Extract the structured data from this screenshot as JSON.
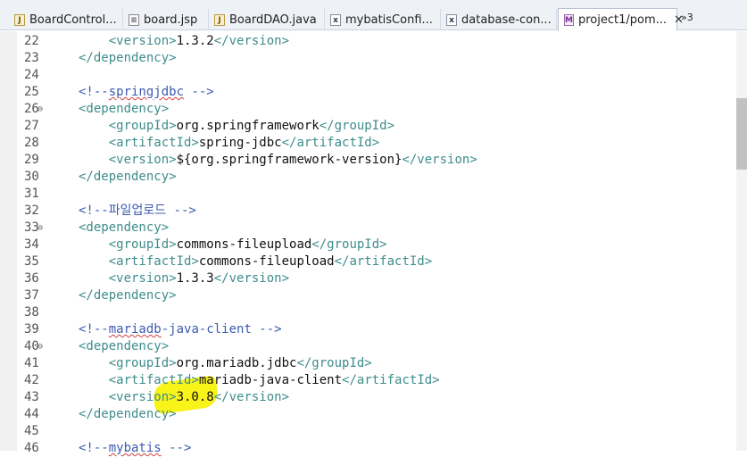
{
  "tabs": [
    {
      "label": "BoardControl...",
      "icon": "java-file-icon"
    },
    {
      "label": "board.jsp",
      "icon": "jsp-file-icon"
    },
    {
      "label": "BoardDAO.java",
      "icon": "java-file-icon"
    },
    {
      "label": "mybatisConfi...",
      "icon": "xml-file-icon"
    },
    {
      "label": "database-con...",
      "icon": "xml-file-icon"
    },
    {
      "label": "project1/pom...",
      "icon": "pom-file-icon",
      "active": true
    }
  ],
  "overflow_label": "»3",
  "lines": [
    {
      "n": "22",
      "fold": false,
      "indent": "    ",
      "parts": [
        [
          "tag",
          "<version>"
        ],
        [
          "txt",
          "1.3.2"
        ],
        [
          "tag",
          "</version>"
        ]
      ]
    },
    {
      "n": "23",
      "fold": false,
      "indent": "",
      "parts": [
        [
          "tag",
          "</dependency>"
        ]
      ]
    },
    {
      "n": "24",
      "fold": false,
      "indent": "",
      "parts": []
    },
    {
      "n": "25",
      "fold": false,
      "indent": "",
      "parts": [
        [
          "cmt",
          "<!--"
        ],
        [
          "cmt-sq",
          "springjdbc"
        ],
        [
          "cmt",
          " -->"
        ]
      ]
    },
    {
      "n": "26",
      "fold": true,
      "indent": "",
      "parts": [
        [
          "tag",
          "<dependency>"
        ]
      ]
    },
    {
      "n": "27",
      "fold": false,
      "indent": "    ",
      "parts": [
        [
          "tag",
          "<groupId>"
        ],
        [
          "txt",
          "org.springframework"
        ],
        [
          "tag",
          "</groupId>"
        ]
      ]
    },
    {
      "n": "28",
      "fold": false,
      "indent": "    ",
      "parts": [
        [
          "tag",
          "<artifactId>"
        ],
        [
          "txt",
          "spring-jdbc"
        ],
        [
          "tag",
          "</artifactId>"
        ]
      ]
    },
    {
      "n": "29",
      "fold": false,
      "indent": "    ",
      "parts": [
        [
          "tag",
          "<version>"
        ],
        [
          "txt",
          "${org.springframework-version}"
        ],
        [
          "tag",
          "</version>"
        ]
      ]
    },
    {
      "n": "30",
      "fold": false,
      "indent": "",
      "parts": [
        [
          "tag",
          "</dependency>"
        ]
      ]
    },
    {
      "n": "31",
      "fold": false,
      "indent": "",
      "parts": []
    },
    {
      "n": "32",
      "fold": false,
      "indent": "",
      "parts": [
        [
          "cmt",
          "<!--파일업로드 -->"
        ]
      ]
    },
    {
      "n": "33",
      "fold": true,
      "indent": "",
      "parts": [
        [
          "tag",
          "<dependency>"
        ]
      ]
    },
    {
      "n": "34",
      "fold": false,
      "indent": "    ",
      "parts": [
        [
          "tag",
          "<groupId>"
        ],
        [
          "txt",
          "commons-fileupload"
        ],
        [
          "tag",
          "</groupId>"
        ]
      ]
    },
    {
      "n": "35",
      "fold": false,
      "indent": "    ",
      "parts": [
        [
          "tag",
          "<artifactId>"
        ],
        [
          "txt",
          "commons-fileupload"
        ],
        [
          "tag",
          "</artifactId>"
        ]
      ]
    },
    {
      "n": "36",
      "fold": false,
      "indent": "    ",
      "parts": [
        [
          "tag",
          "<version>"
        ],
        [
          "txt",
          "1.3.3"
        ],
        [
          "tag",
          "</version>"
        ]
      ]
    },
    {
      "n": "37",
      "fold": false,
      "indent": "",
      "parts": [
        [
          "tag",
          "</dependency>"
        ]
      ]
    },
    {
      "n": "38",
      "fold": false,
      "indent": "",
      "parts": []
    },
    {
      "n": "39",
      "fold": false,
      "indent": "",
      "parts": [
        [
          "cmt",
          "<!--"
        ],
        [
          "cmt-sq",
          "mariadb"
        ],
        [
          "cmt",
          "-java-client -->"
        ]
      ]
    },
    {
      "n": "40",
      "fold": true,
      "indent": "",
      "parts": [
        [
          "tag",
          "<dependency>"
        ]
      ]
    },
    {
      "n": "41",
      "fold": false,
      "indent": "    ",
      "parts": [
        [
          "tag",
          "<groupId>"
        ],
        [
          "txt",
          "org.mariadb.jdbc"
        ],
        [
          "tag",
          "</groupId>"
        ]
      ]
    },
    {
      "n": "42",
      "fold": false,
      "indent": "    ",
      "parts": [
        [
          "tag",
          "<artifactId>"
        ],
        [
          "txt",
          "mariadb-java-client"
        ],
        [
          "tag",
          "</artifactId>"
        ]
      ]
    },
    {
      "n": "43",
      "fold": false,
      "indent": "    ",
      "parts": [
        [
          "tag",
          "<version>"
        ],
        [
          "txt",
          "3.0.8"
        ],
        [
          "tag",
          "</version>"
        ]
      ]
    },
    {
      "n": "44",
      "fold": false,
      "indent": "",
      "parts": [
        [
          "tag",
          "</dependency>"
        ]
      ]
    },
    {
      "n": "45",
      "fold": false,
      "indent": "",
      "parts": []
    },
    {
      "n": "46",
      "fold": false,
      "indent": "",
      "parts": [
        [
          "cmt",
          "<!--"
        ],
        [
          "cmt-sq",
          "mybatis"
        ],
        [
          "cmt",
          " -->"
        ]
      ]
    }
  ],
  "colors": {
    "tag": "#3f8c8c",
    "text": "#111111",
    "comment": "#3a5bb0",
    "highlight": "#f7f200"
  }
}
